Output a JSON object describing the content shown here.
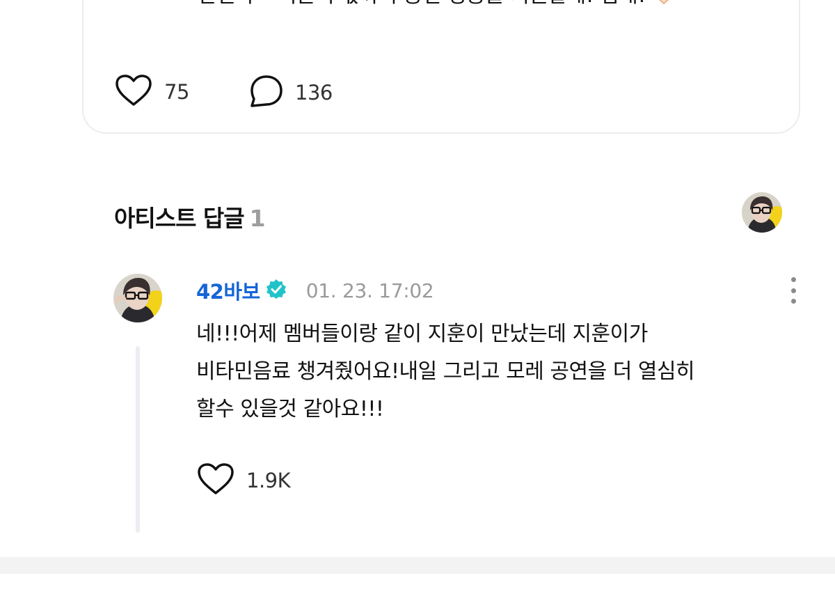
{
  "post": {
    "text": "한진아~ 지훈이 몫까지 공연 성공을 기원할게! 힘내!",
    "emoji_icon": "heart-hands-emoji",
    "like_count": "75",
    "comment_count": "136"
  },
  "artist_reply": {
    "section_title": "아티스트 답글",
    "section_count": "1"
  },
  "reply": {
    "author": "42바보",
    "verified_badge_icon": "verified-badge-icon",
    "timestamp": "01. 23. 17:02",
    "body_lines": [
      "네!!!어제 멤버들이랑 같이 지훈이 만났는데 지훈이가",
      "비타민음료 챙겨줬어요!내일 그리고 모레 공연을 더 열심히",
      "할수 있을것 같아요!!!"
    ],
    "like_count": "1.9K"
  },
  "colors": {
    "author": "#1565d8",
    "verified_badge": "#22c3c8",
    "muted_text": "#9a9a9a",
    "thread_line": "#ececf2"
  }
}
